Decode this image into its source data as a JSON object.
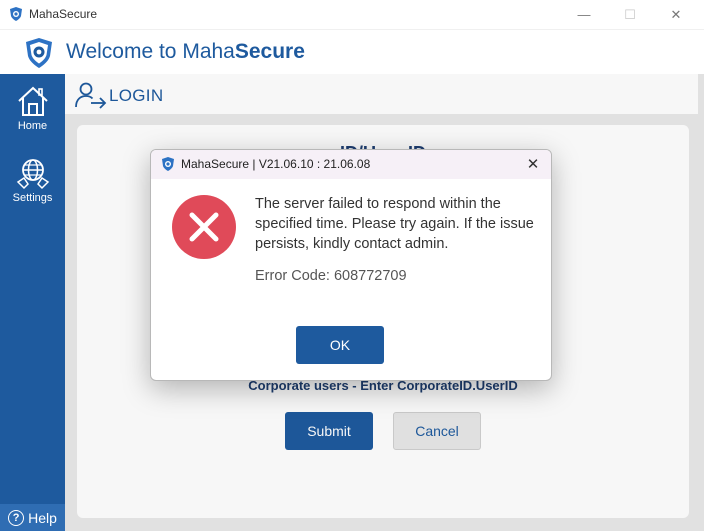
{
  "window": {
    "title": "MahaSecure",
    "minimize": "—",
    "maximize": "☐",
    "close": "✕"
  },
  "header": {
    "welcome_prefix": "Welcome to Maha",
    "welcome_brand": "Secure"
  },
  "sidebar": {
    "items": [
      {
        "label": "Home",
        "icon": "home-icon"
      },
      {
        "label": "Settings",
        "icon": "settings-globe-icon"
      }
    ],
    "help_label": "Help",
    "help_icon": "?"
  },
  "page": {
    "title": "LOGIN",
    "hidden_title": "ID/User ID",
    "corporate_hint": "Corporate users - Enter CorporateID.UserID",
    "submit_label": "Submit",
    "cancel_label": "Cancel"
  },
  "dialog": {
    "title": "MahaSecure | V21.06.10 : 21.06.08",
    "close": "✕",
    "message": "The server failed to respond within the specified time. Please try again. If the issue persists, kindly contact admin.",
    "error_code": "Error Code: 608772709",
    "ok_label": "OK"
  },
  "colors": {
    "brand": "#1e5a9e",
    "error": "#e04a59"
  }
}
